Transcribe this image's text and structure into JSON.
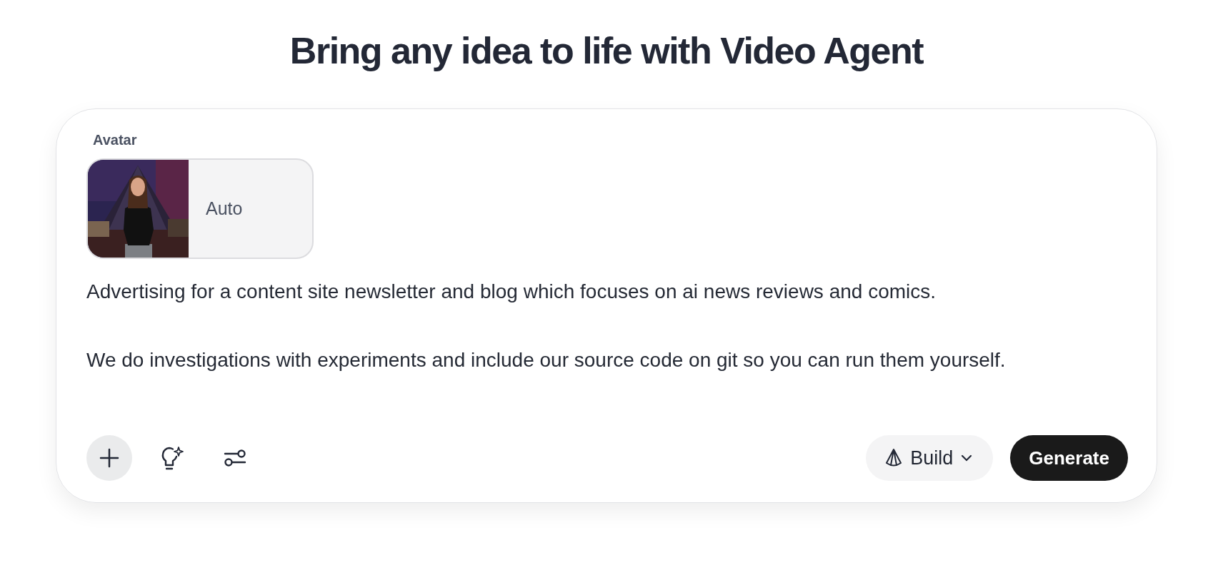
{
  "heading": "Bring any idea to life with Video Agent",
  "avatar": {
    "label": "Avatar",
    "choice": "Auto"
  },
  "prompt": {
    "value": "Advertising for a content site newsletter and blog which focuses on ai news reviews and comics.\n\nWe do investigations with experiments and include our source code on git so you can run them yourself."
  },
  "mode": {
    "label": "Build"
  },
  "generate": {
    "label": "Generate"
  }
}
